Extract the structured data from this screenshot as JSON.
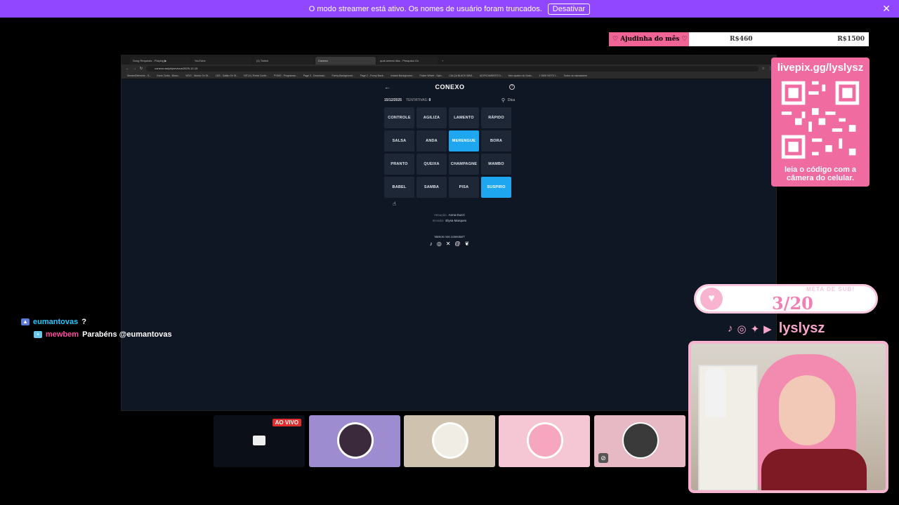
{
  "banner": {
    "message": "O modo streamer está ativo. Os nomes de usuário foram truncados.",
    "button": "Desativar",
    "close": "✕"
  },
  "goal": {
    "label": "♡ Ajudinha do mês ♡",
    "current": "R$460",
    "target": "R$1500",
    "progress_fraction": 0.31
  },
  "browser": {
    "tabs": [
      "Song Requests - Playing ▶",
      "YouTube",
      "(1) Twitch",
      "Conexo",
      "qual animal diss - Pesquisa Go"
    ],
    "active_tab": 3,
    "url": "conexo.ws/pt/previous/2025-12-15",
    "bookmarks": [
      "StreamElements - S...",
      "Sonic Gotta - Bloco...",
      "WCG - Words On St...",
      "LDS - Gatão On St...",
      "NITLA | Portal Confir...",
      "PGMG - Programas...",
      "Page 3 - Download...",
      "Funny Background...",
      "Page 2 - Funny Back...",
      "Instant Background...",
      "Pokee Wheel - Spin...",
      "CALÇA BLACK WAS...",
      "ADIFICAMENTO D...",
      "Meu quadro do Sodo...",
      "1 2606 NOTS 1...",
      "Todos os marcadores"
    ]
  },
  "game": {
    "back": "←",
    "title": "CONEXO",
    "help": "?",
    "date": "15/12/2025",
    "tries_label": "TENTATIVAS:",
    "tries_value": "0",
    "hint": "Dica",
    "words": [
      {
        "text": "CONTROLE",
        "selected": false
      },
      {
        "text": "AGILIZA",
        "selected": false
      },
      {
        "text": "LAMENTO",
        "selected": false
      },
      {
        "text": "RÁPIDO",
        "selected": false
      },
      {
        "text": "SALSA",
        "selected": false
      },
      {
        "text": "ANDA",
        "selected": false
      },
      {
        "text": "MERENGUE",
        "selected": true
      },
      {
        "text": "BORA",
        "selected": false
      },
      {
        "text": "PRANTO",
        "selected": false
      },
      {
        "text": "QUEIXA",
        "selected": false
      },
      {
        "text": "CHAMPAGNE",
        "selected": false
      },
      {
        "text": "MAMBO",
        "selected": false
      },
      {
        "text": "BABEL",
        "selected": false
      },
      {
        "text": "SAMBA",
        "selected": false
      },
      {
        "text": "PISA",
        "selected": false
      },
      {
        "text": "SUSPIRO",
        "selected": true
      }
    ],
    "redacao_label": "REDAÇÃO:",
    "redacao_name": "Anna Duzzi",
    "revisao_label": "REVISÃO:",
    "revisao_name": "Elysa Marques",
    "connect": "Vamos nos conectar?",
    "selected_color": "#1ea7f0"
  },
  "qr": {
    "url": "livepix.gg/lyslysz",
    "caption_1": "leia o código com a",
    "caption_2": "câmera do celular."
  },
  "subgoal": {
    "label": "META DE SUB!",
    "value": "3/20"
  },
  "channel": {
    "name": "lyslysz"
  },
  "chat": [
    {
      "user": "eumantovas",
      "text": "?"
    },
    {
      "user": "mewbem",
      "text": "Parabéns @eumantovas"
    }
  ],
  "guests": {
    "live_badge": "AO VIVO"
  },
  "colors": {
    "banner": "#9147ff",
    "pink": "#f06ba0",
    "accent_blue": "#1ea7f0"
  }
}
